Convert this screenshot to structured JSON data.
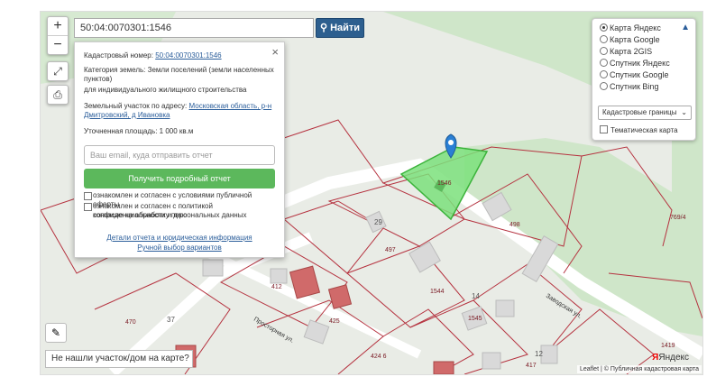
{
  "search": {
    "value": "50:04:0070301:1546",
    "button_label": "Найти"
  },
  "zoom": {
    "in": "+",
    "out": "−"
  },
  "popup": {
    "cad_label": "Кадастровый номер:",
    "cad_number": "50:04:0070301:1546",
    "category_label": "Категория земель:",
    "category_value": "Земли поселений (земли населенных пунктов)",
    "purpose": "для индивидуального жилищного строительства",
    "address_label": "Земельный участок по адресу:",
    "address_value": "Московская область, р-н Дмитровский, д Ивановка",
    "area_label": "Уточненная площадь:",
    "area_value": "1 000 кв.м",
    "email_placeholder": "Ваш email, куда отправить отчет",
    "get_report": "Получить подробный отчет",
    "agree1": "ознакомлен и согласен с условиями публичной оферты",
    "agree2_a": "ознакомлен и согласен с политикой конфиденциальности и даю",
    "agree2_b": "согласие на обработку персональных данных",
    "link1": "Детали отчета и юридическая информация",
    "link2": "Ручной выбор вариантов",
    "close": "×"
  },
  "layers": {
    "options": [
      "Карта Яндекс",
      "Карта Google",
      "Карта 2GIS",
      "Спутник Яндекс",
      "Спутник Google",
      "Спутник Bing"
    ],
    "selected": "Карта Яндекс",
    "overlay_select": "Кадастровые границы",
    "topo_label": "Тематическая карта"
  },
  "map": {
    "labels": {
      "p1546": "1546",
      "p498": "498",
      "p7694": "769/4",
      "p29": "29",
      "p497": "497",
      "p412": "412",
      "p425": "425",
      "p1544": "1544",
      "p14": "14",
      "p1545": "1545",
      "p470": "470",
      "p37": "37",
      "p4246": "424 6",
      "p417": "417",
      "p12": "12",
      "p1419": "1419",
      "street1": "Заводская ул.",
      "street2": "Просторная ул."
    }
  },
  "bottom": {
    "not_found": "Не нашли участок/дом на карте?"
  },
  "attribution": {
    "text": "Leaflet | © Публичная кадастровая карта",
    "yandex": "Яндекс"
  }
}
